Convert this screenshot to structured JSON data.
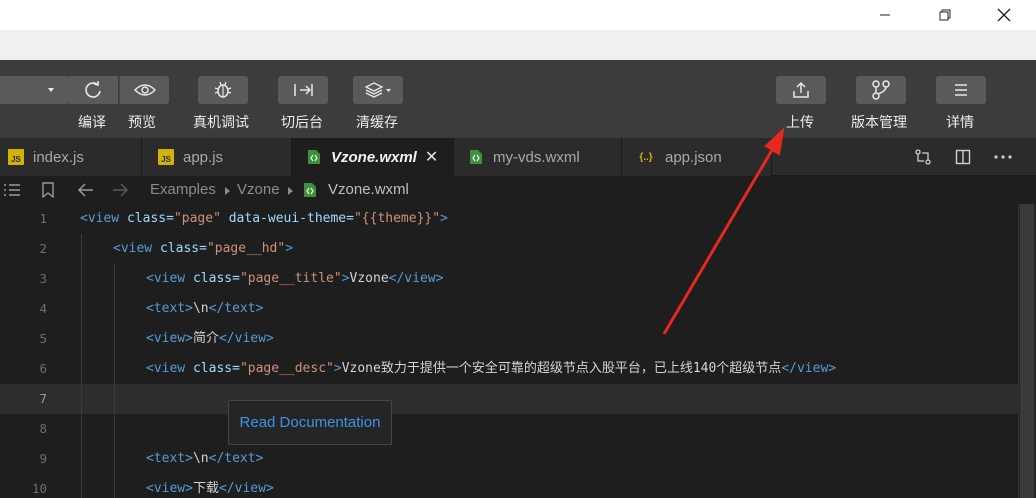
{
  "window_controls": {
    "minimize": "—",
    "maximize": "❐",
    "close": "✕"
  },
  "toolbar": {
    "buttons": [
      {
        "label": "编译",
        "icon": "refresh-icon"
      },
      {
        "label": "预览",
        "icon": "eye-icon"
      },
      {
        "label": "真机调试",
        "icon": "bug-icon"
      },
      {
        "label": "切后台",
        "icon": "switch-background-icon"
      },
      {
        "label": "清缓存",
        "icon": "layers-icon"
      },
      {
        "label": "上传",
        "icon": "upload-icon"
      },
      {
        "label": "版本管理",
        "icon": "branch-icon"
      },
      {
        "label": "详情",
        "icon": "menu-icon"
      }
    ]
  },
  "tabs": [
    {
      "label": "index.js",
      "icon": "JS"
    },
    {
      "label": "app.js",
      "icon": "JS"
    },
    {
      "label": "Vzone.wxml",
      "icon": "wxml",
      "active": true,
      "close": "✕"
    },
    {
      "label": "my-vds.wxml",
      "icon": "wxml"
    },
    {
      "label": "app.json",
      "icon": "{..}"
    }
  ],
  "breadcrumb": {
    "items": [
      "Examples",
      "Vzone",
      "Vzone.wxml"
    ]
  },
  "editor": {
    "lines": [
      {
        "n": "1"
      },
      {
        "n": "2"
      },
      {
        "n": "3"
      },
      {
        "n": "4"
      },
      {
        "n": "5"
      },
      {
        "n": "6"
      },
      {
        "n": "7"
      },
      {
        "n": "8"
      },
      {
        "n": "9"
      },
      {
        "n": "10"
      }
    ],
    "code": {
      "l1": {
        "open": "<view",
        "attr1": " class=",
        "val1": "\"page\"",
        "attr2": " data-weui-theme=",
        "val2": "\"{{theme}}\"",
        "close": ">"
      },
      "l2": {
        "open": "<view",
        "attr1": " class=",
        "val1": "\"page__hd\"",
        "close": ">"
      },
      "l3": {
        "open": "<view",
        "attr1": " class=",
        "val1": "\"page__title\"",
        "gt": ">",
        "text": "Vzone",
        "end": "</view>"
      },
      "l4": {
        "open": "<text>",
        "text": "\\n",
        "end": "</text>"
      },
      "l5": {
        "open": "<view>",
        "text": "简介",
        "end": "</view>"
      },
      "l6": {
        "open": "<view",
        "attr1": " class=",
        "val1": "\"page__desc\"",
        "gt": ">",
        "text": "Vzone致力于提供一个安全可靠的超级节点入股平台，已上线140个超级节点",
        "end": "</view>"
      },
      "l9": {
        "open": "<text>",
        "text": "\\n",
        "end": "</text>"
      },
      "l10": {
        "open": "<view>",
        "text": "下载",
        "end": "</view>"
      }
    },
    "current_line": "7"
  },
  "tooltip": {
    "label": "Read Documentation"
  },
  "colors": {
    "arrow": "#e8281e",
    "link": "#3b94e8"
  }
}
